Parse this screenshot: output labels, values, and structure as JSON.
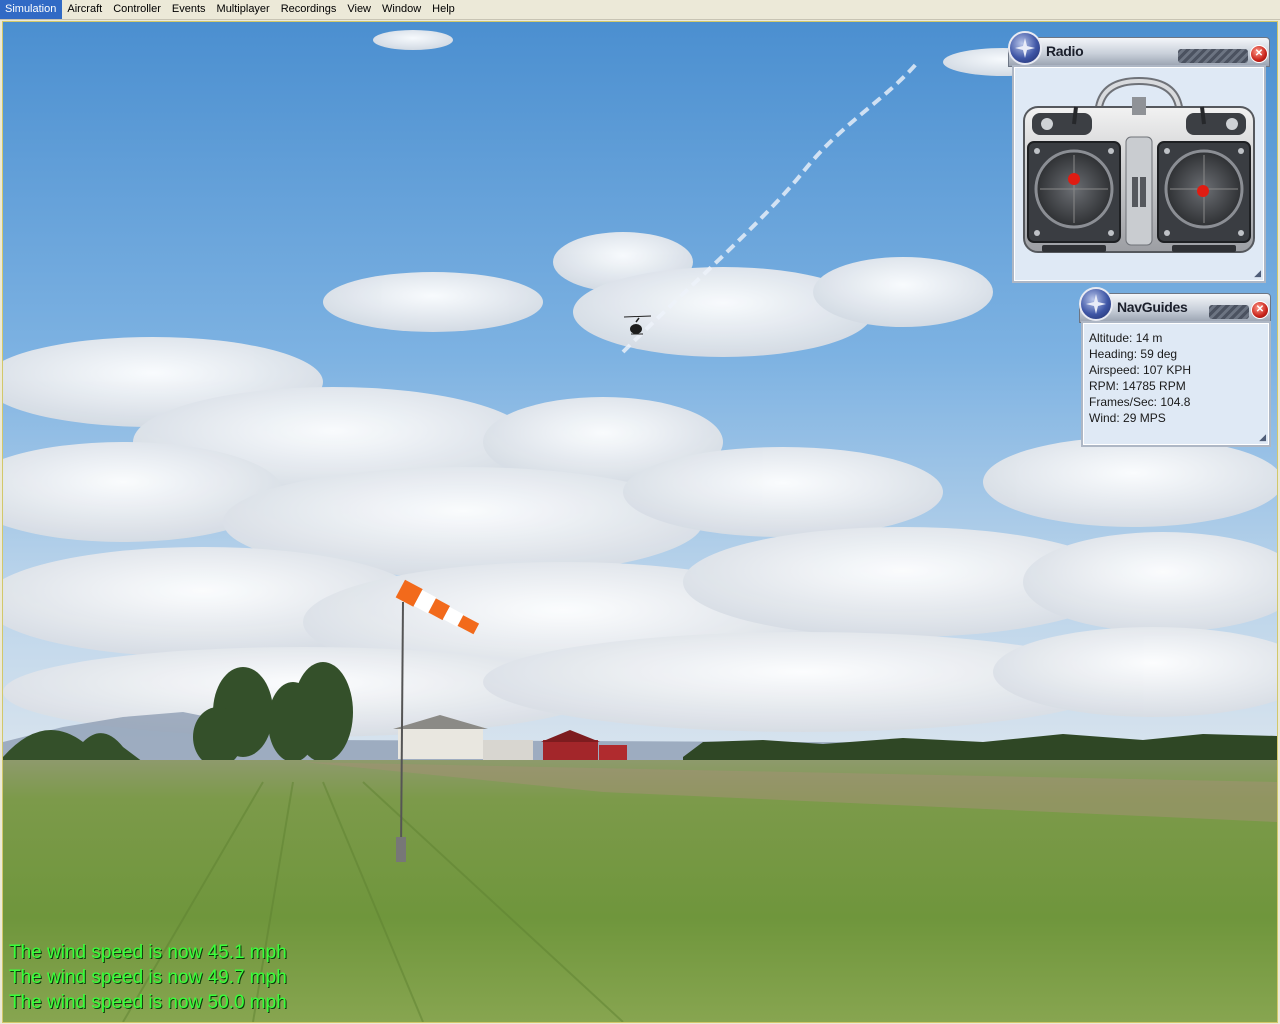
{
  "menu": [
    "Simulation",
    "Aircraft",
    "Controller",
    "Events",
    "Multiplayer",
    "Recordings",
    "View",
    "Window",
    "Help"
  ],
  "radio_panel": {
    "title": "Radio"
  },
  "nav_panel": {
    "title": "NavGuides",
    "rows": [
      {
        "label": "Altitude:",
        "value": "14 m"
      },
      {
        "label": "Heading:",
        "value": "59 deg"
      },
      {
        "label": "Airspeed:",
        "value": "107 KPH"
      },
      {
        "label": "RPM:",
        "value": "14785 RPM"
      },
      {
        "label": "Frames/Sec:",
        "value": "104.8"
      },
      {
        "label": "Wind:",
        "value": "29 MPS"
      }
    ]
  },
  "messages": [
    "The wind speed is now 45.1 mph",
    "The wind speed is now 49.7 mph",
    "The wind speed is now 50.0 mph"
  ],
  "colors": {
    "message": "#39ff3a",
    "sky": "#5b9ad6",
    "grass": "#6f9a3c",
    "windsock_stripe": "#f26a1b"
  }
}
